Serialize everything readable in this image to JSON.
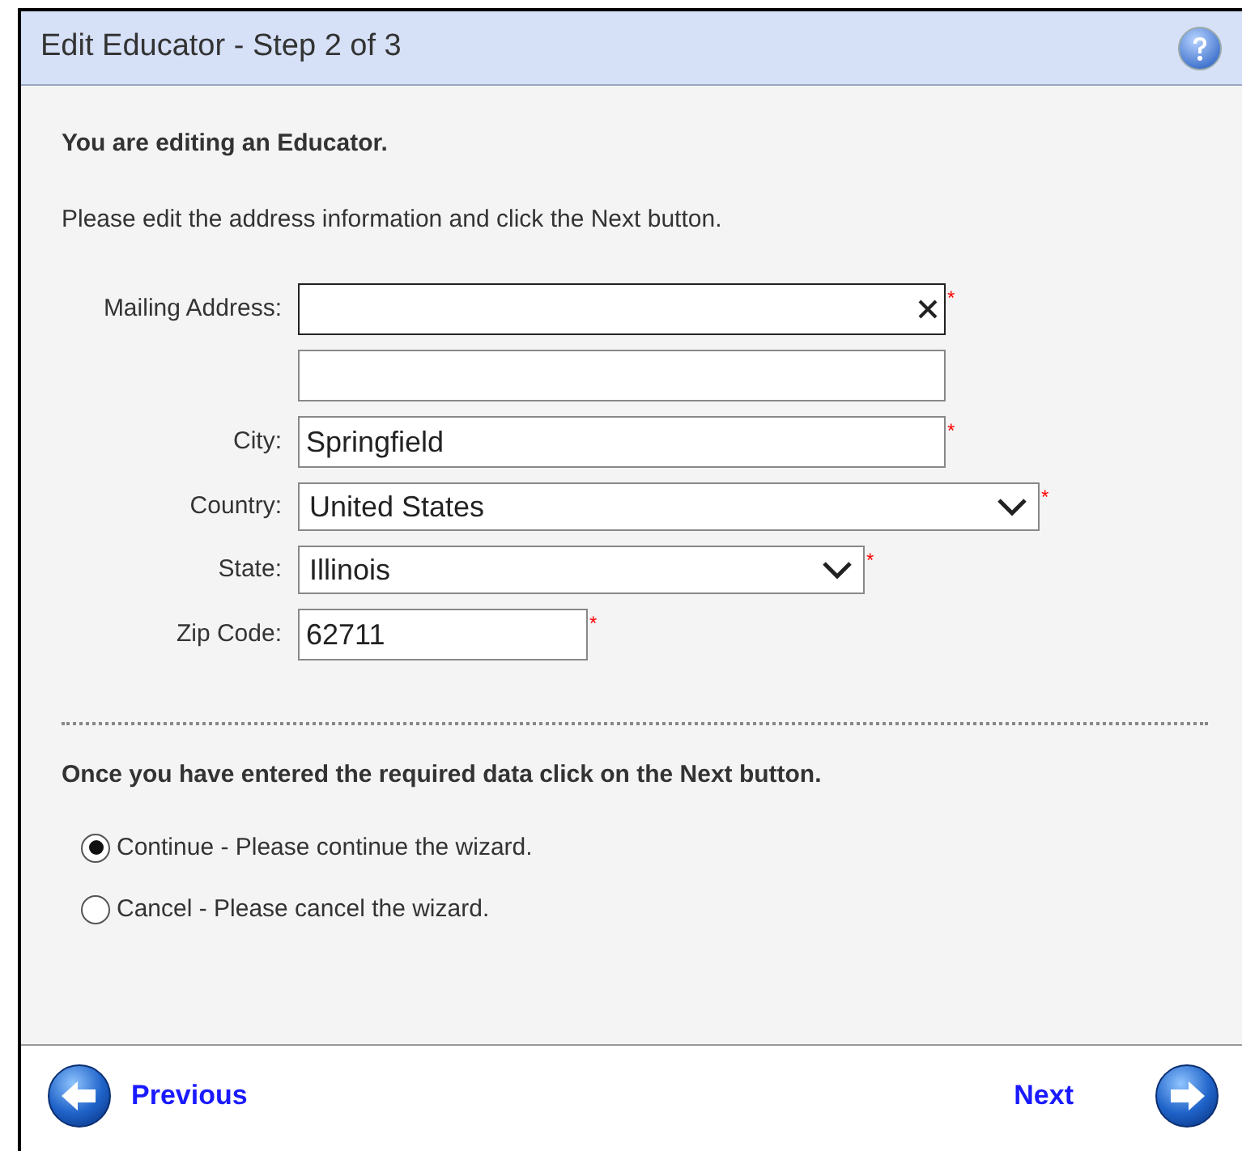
{
  "window": {
    "title": "Edit Educator - Step 2 of 3"
  },
  "heading": "You are editing an Educator.",
  "instruction": "Please edit the address information and click the Next button.",
  "fields": [
    {
      "kind": "text",
      "label": "Mailing Address:",
      "required_mark": "*",
      "clearable": true,
      "focused": true
    },
    {
      "kind": "text",
      "focused": false
    },
    {
      "kind": "text",
      "label": "City:",
      "value": "Springfield",
      "required_mark": "*",
      "focused": false
    },
    {
      "kind": "select",
      "label": "Country:",
      "value": "United States",
      "required_mark": "*",
      "focused": false
    },
    {
      "kind": "select",
      "label": "State:",
      "value": "Illinois",
      "required_mark": "*",
      "focused": false
    },
    {
      "kind": "text",
      "label": "Zip Code:",
      "value": "62711",
      "required_mark": "*",
      "focused": false
    }
  ],
  "note": "Once you have entered the required data click on the Next button.",
  "options": [
    {
      "label": "Continue - Please continue the wizard.",
      "selected": true
    },
    {
      "label": "Cancel - Please cancel the wizard.",
      "selected": false
    }
  ],
  "footer": {
    "previous": "Previous",
    "next": "Next"
  }
}
